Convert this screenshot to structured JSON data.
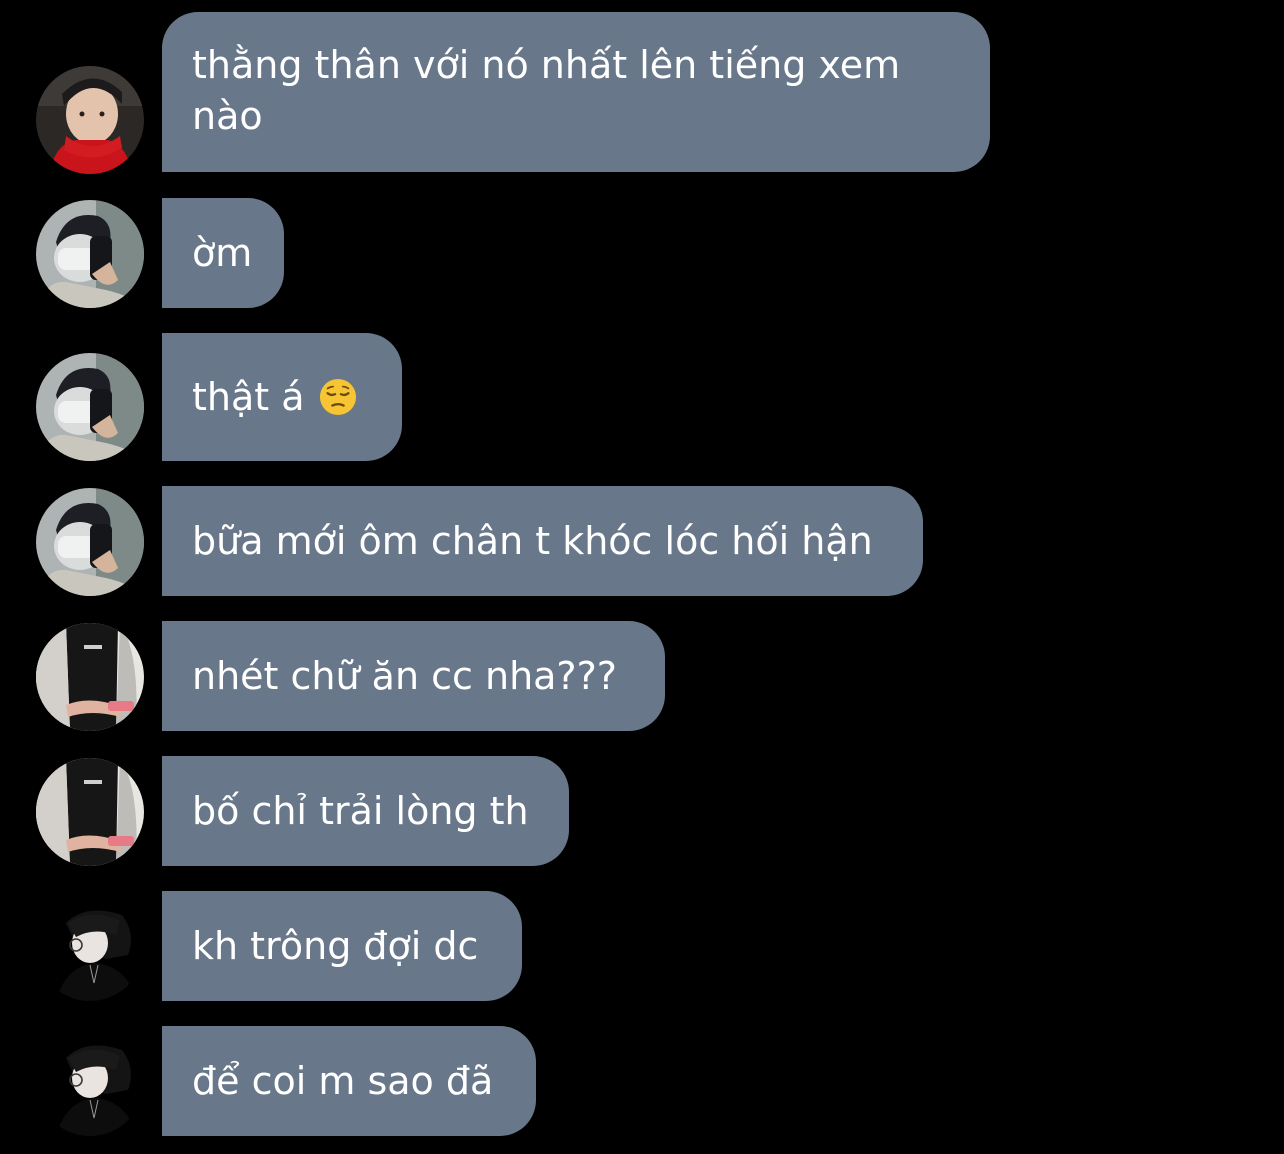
{
  "messages": [
    {
      "sender": "avatar-red-scarf",
      "text": "thằng thân với nó nhất lên tiếng xem nào"
    },
    {
      "sender": "avatar-masked-mirror",
      "text": "ờm"
    },
    {
      "sender": "avatar-masked-mirror",
      "text": "thật á",
      "emoji": "pensive-face-icon"
    },
    {
      "sender": "avatar-masked-mirror",
      "text": "bữa mới ôm chân t khóc lóc hối hận"
    },
    {
      "sender": "avatar-cardigan",
      "text": "nhét chữ ăn cc nha???"
    },
    {
      "sender": "avatar-cardigan",
      "text": "bố chỉ trải lòng th"
    },
    {
      "sender": "avatar-glasses-profile",
      "text": "kh trông đợi dc"
    },
    {
      "sender": "avatar-glasses-profile",
      "text": "để coi m sao đã"
    }
  ],
  "colors": {
    "background": "#000000",
    "bubble": "#687789",
    "text": "#ffffff"
  }
}
